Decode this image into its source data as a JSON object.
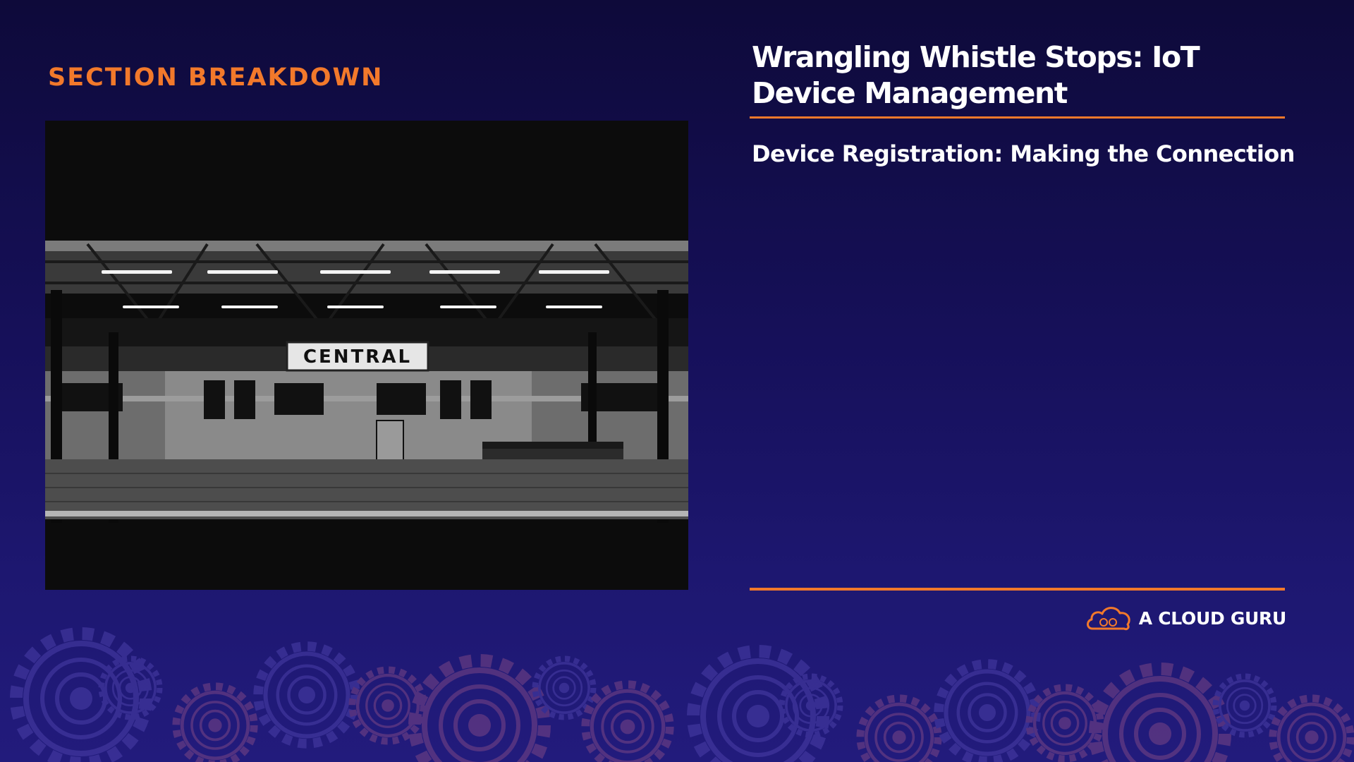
{
  "section_label": "SECTION BREAKDOWN",
  "course_title": "Wrangling Whistle Stops: IoT Device Management",
  "lesson_title": "Device Registration: Making the Connection",
  "photo": {
    "sign_text": "CENTRAL",
    "subject": "night-train-platform-photo"
  },
  "brand": {
    "name": "A CLOUD GURU",
    "icon": "cloud-logo-icon"
  },
  "colors": {
    "accent": "#f2792b",
    "background_top": "#0e0a3a",
    "background_bottom": "#221b7c",
    "text": "#ffffff",
    "gear_purple": "#4a3fa8",
    "gear_orange": "#7a4585"
  }
}
